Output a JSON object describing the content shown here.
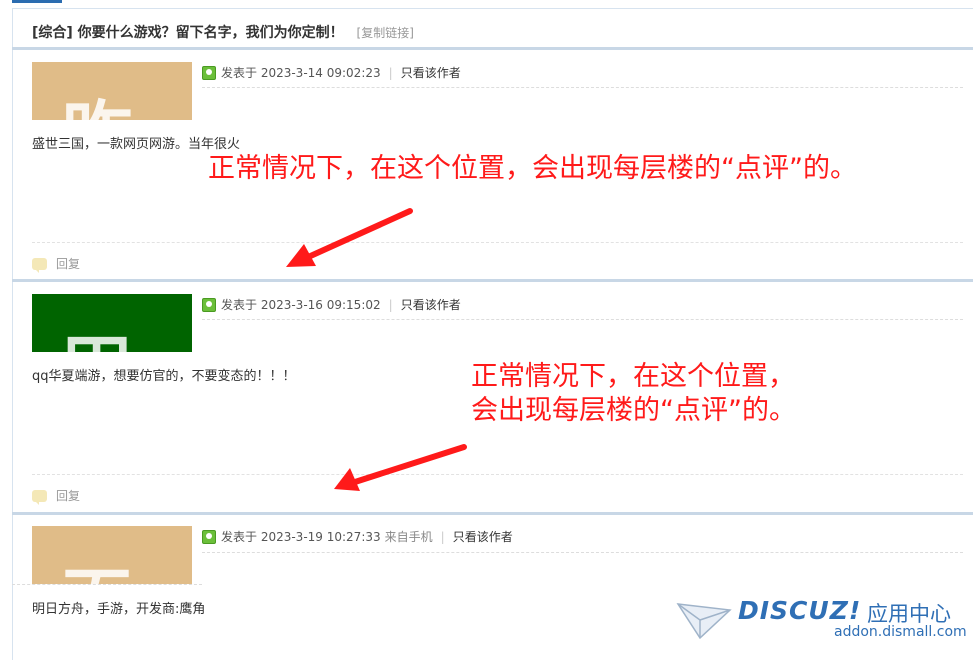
{
  "thread": {
    "title": "[综合] 你要什么游戏？留下名字，我们为你定制！",
    "copy_link": "[复制链接]"
  },
  "posts": [
    {
      "meta": "发表于 2023-3-14 09:02:23",
      "from": "",
      "only_author": "只看该作者",
      "content": "盛世三国，一款网页网游。当年很火",
      "reply": "回复",
      "avatar_color": "#e0bc88",
      "avatar_glyph": "昨"
    },
    {
      "meta": "发表于 2023-3-16 09:15:02",
      "from": "",
      "only_author": "只看该作者",
      "content": "qq华夏端游，想要仿官的，不要变态的！！！",
      "reply": "回复",
      "avatar_color": "#006400",
      "avatar_glyph": "田"
    },
    {
      "meta": "发表于 2023-3-19 10:27:33",
      "from": "来自手机",
      "only_author": "只看该作者",
      "content": "明日方舟，手游，开发商:鹰角",
      "avatar_color": "#e0bc88",
      "avatar_glyph": "百"
    }
  ],
  "annotations": [
    {
      "lines": [
        "正常情况下，在这个位置，会出现每层楼的“点评”的。"
      ]
    },
    {
      "lines": [
        "正常情况下，在这个位置，",
        "会出现每层楼的“点评”的。"
      ]
    }
  ],
  "watermark": {
    "brand": "DISCUZ!",
    "cn": "应用中心",
    "url": "addon.dismall.com"
  },
  "colors": {
    "annotation": "#ff1a1a",
    "separator": "#c8d7e6",
    "watermark": "#2f6fb5"
  }
}
